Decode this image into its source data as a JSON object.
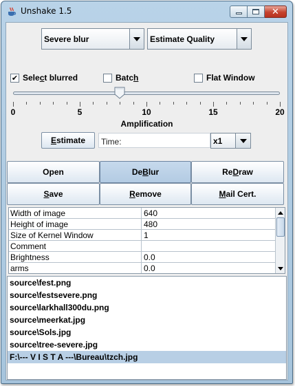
{
  "window": {
    "title": "Unshake 1.5",
    "icons": {
      "app": "java-cup-icon",
      "minimize": "minimize-icon",
      "maximize": "maximize-icon",
      "close": "close-icon"
    }
  },
  "controls": {
    "blur_type": {
      "selected": "Severe blur"
    },
    "mode": {
      "selected": "Estimate Quality"
    },
    "checkboxes": [
      {
        "pre": "Sele",
        "mn": "c",
        "post": "t blurred",
        "checked": true
      },
      {
        "pre": "Batc",
        "mn": "h",
        "post": "",
        "checked": false
      },
      {
        "pre": "Flat Window",
        "mn": "",
        "post": "",
        "checked": false
      }
    ]
  },
  "slider": {
    "label": "Amplification",
    "min": 0,
    "max": 20,
    "value": 8,
    "tick_labels": [
      "0",
      "5",
      "10",
      "15",
      "20"
    ]
  },
  "estimate": {
    "button": {
      "mn": "E",
      "post": "stimate"
    },
    "time_label": "Time:",
    "time_value": "",
    "scale": {
      "selected": "x1"
    }
  },
  "actions": [
    {
      "pre": "",
      "mn": "",
      "post": "Open",
      "pressed": false
    },
    {
      "pre": "De",
      "mn": "B",
      "post": "lur",
      "pressed": true
    },
    {
      "pre": "Re",
      "mn": "D",
      "post": "raw",
      "pressed": false
    },
    {
      "pre": "",
      "mn": "S",
      "post": "ave",
      "pressed": false
    },
    {
      "pre": "",
      "mn": "R",
      "post": "emove",
      "pressed": false
    },
    {
      "pre": "",
      "mn": "M",
      "post": "ail Cert.",
      "pressed": false
    }
  ],
  "properties": [
    {
      "name": "Width of image",
      "value": "640"
    },
    {
      "name": "Height of image",
      "value": "480"
    },
    {
      "name": "Size of Kernel Window",
      "value": "1"
    },
    {
      "name": "Comment",
      "value": ""
    },
    {
      "name": "Brightness",
      "value": "0.0"
    },
    {
      "name": "arms",
      "value": "0.0"
    }
  ],
  "files": [
    {
      "path": "source\\fest.png",
      "selected": false
    },
    {
      "path": "source\\festsevere.png",
      "selected": false
    },
    {
      "path": "source\\larkhall300du.png",
      "selected": false
    },
    {
      "path": "source\\meerkat.jpg",
      "selected": false
    },
    {
      "path": "source\\Sols.jpg",
      "selected": false
    },
    {
      "path": "source\\tree-severe.jpg",
      "selected": false
    },
    {
      "path": "F:\\--- V I S T A ---\\Bureau\\tzch.jpg",
      "selected": true
    }
  ],
  "colors": {
    "selection": "#b8cfe5",
    "close_button": "#c5432e",
    "pressed_button": "#b3cbe3"
  }
}
